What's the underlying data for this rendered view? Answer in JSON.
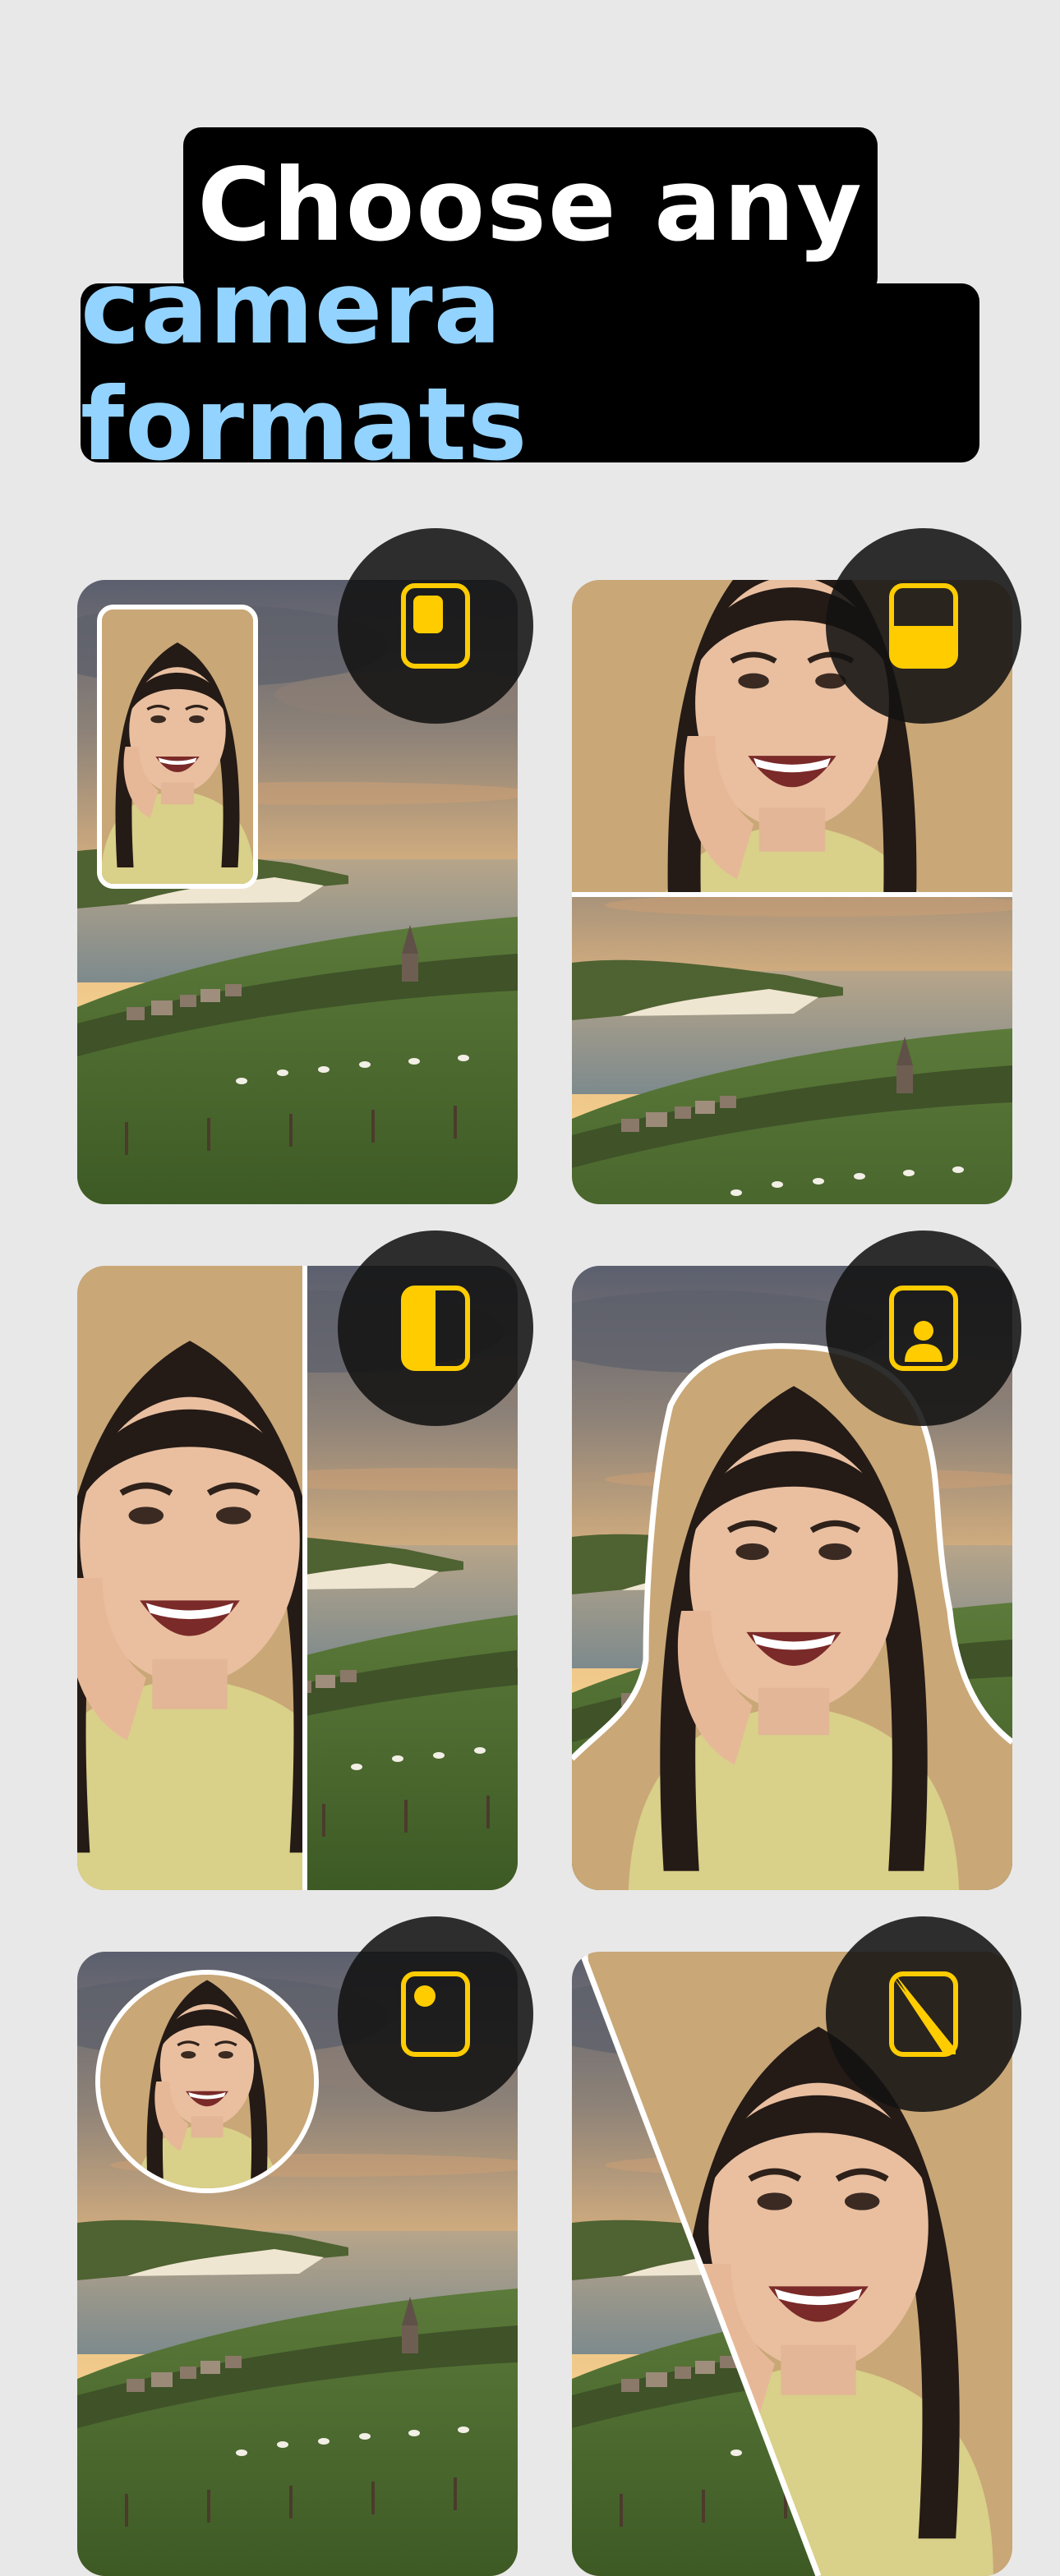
{
  "headline": {
    "line1": "Choose any",
    "line2": "camera formats"
  },
  "colors": {
    "background": "#e8e8e8",
    "headline_box": "#000000",
    "headline_line1": "#ffffff",
    "headline_line2": "#93d3ff",
    "badge": "#121212",
    "icon_accent": "#ffcc00",
    "frame_border": "#ffffff"
  },
  "formats": [
    {
      "id": "picture-in-picture",
      "icon": "pip-rect-icon"
    },
    {
      "id": "split-horizontal",
      "icon": "split-horizontal-icon"
    },
    {
      "id": "split-vertical",
      "icon": "split-vertical-icon"
    },
    {
      "id": "cutout-person",
      "icon": "person-cutout-icon"
    },
    {
      "id": "picture-in-picture-circle",
      "icon": "pip-circle-icon"
    },
    {
      "id": "split-diagonal",
      "icon": "split-diagonal-icon"
    }
  ]
}
